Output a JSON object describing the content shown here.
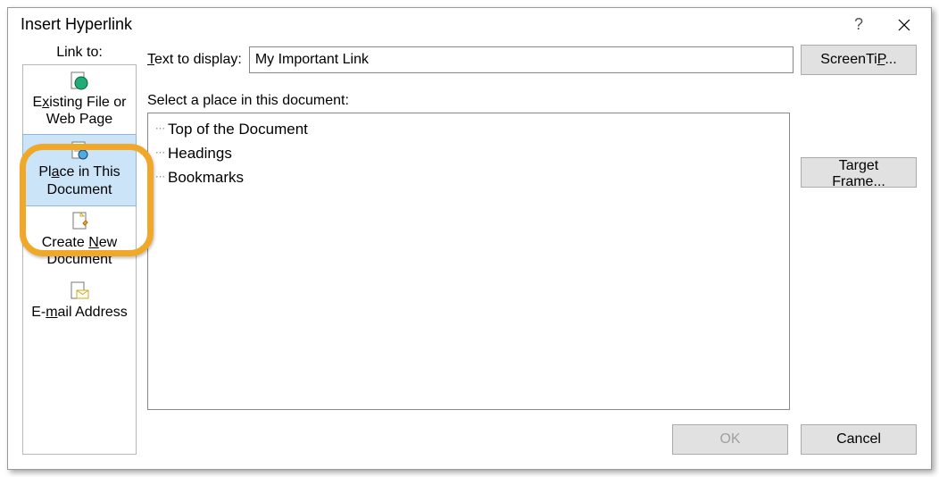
{
  "title": "Insert Hyperlink",
  "linkto_label": "Link to:",
  "sidebar": {
    "items": [
      {
        "label_pre": "E",
        "u": "x",
        "label_post": "isting File or\nWeb Page"
      },
      {
        "label_pre": "Pl",
        "u": "a",
        "label_post": "ce in This\nDocument"
      },
      {
        "label_pre": "Create ",
        "u": "N",
        "label_post": "ew\nDocument"
      },
      {
        "label_pre": "E-",
        "u": "m",
        "label_post": "ail Address"
      }
    ]
  },
  "text_display_u": "T",
  "text_display_label": "ext to display:",
  "text_display_value": "My Important Link",
  "screentip_u": "P",
  "screentip_label": "ScreenTi",
  "screentip_suffix": "...",
  "select_place_label": "Select a place in this document:",
  "tree": {
    "items": [
      "Top of the Document",
      "Headings",
      "Bookmarks"
    ]
  },
  "target_frame_label": "Tar",
  "target_frame_u": "g",
  "target_frame_suffix": "et Frame...",
  "ok_label": "OK",
  "cancel_label": "Cancel"
}
